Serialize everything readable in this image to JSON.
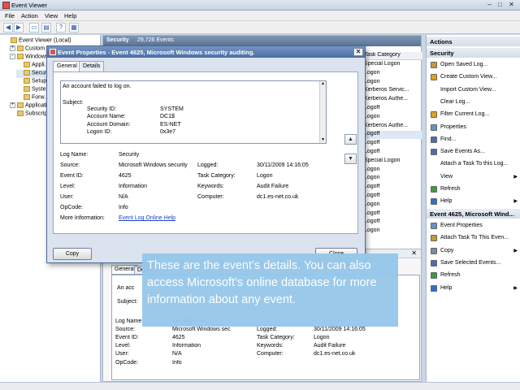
{
  "window": {
    "title": "Event Viewer"
  },
  "menu": [
    "File",
    "Action",
    "View",
    "Help"
  ],
  "toolbar": [
    "back-icon",
    "forward-icon",
    "folder-icon",
    "properties-icon",
    "help-icon",
    "grid-icon"
  ],
  "tree": [
    {
      "label": "Event Viewer (Local)",
      "exp": "",
      "indent": 0
    },
    {
      "label": "Custom V...",
      "exp": "+",
      "indent": 1
    },
    {
      "label": "Windows...",
      "exp": "-",
      "indent": 1
    },
    {
      "label": "Appli...",
      "exp": "",
      "indent": 2
    },
    {
      "label": "Secur...",
      "exp": "",
      "indent": 2,
      "selected": true
    },
    {
      "label": "Setup",
      "exp": "",
      "indent": 2
    },
    {
      "label": "Syste...",
      "exp": "",
      "indent": 2
    },
    {
      "label": "Forw...",
      "exp": "",
      "indent": 2
    },
    {
      "label": "Applicatio...",
      "exp": "+",
      "indent": 1
    },
    {
      "label": "Subscript...",
      "exp": "",
      "indent": 1
    }
  ],
  "center": {
    "title": "Security",
    "count": "29,726 Events",
    "column": "Task Category"
  },
  "list_rows": [
    "Special Logon",
    "Logon",
    "Logon",
    "Kerberos Servic...",
    "Kerberos Authe...",
    "Logoff",
    "Logon",
    "Kerberos Authe...",
    "Logoff",
    "Logoff",
    "Logoff",
    "Special Logon",
    "Logon",
    "Logon",
    "Logoff",
    "Logoff",
    "Logon",
    "Logoff",
    "Logoff",
    "Logon"
  ],
  "dialog": {
    "title": "Event Properties - Event 4625, Microsoft Windows security auditing.",
    "tabs": [
      "General",
      "Details"
    ],
    "message": {
      "line1": "An account failed to log on.",
      "subject": "Subject:",
      "fields": [
        {
          "k": "Security ID:",
          "v": "SYSTEM"
        },
        {
          "k": "Account Name:",
          "v": "DC1$"
        },
        {
          "k": "Account Domain:",
          "v": "ES-NET"
        },
        {
          "k": "Logon ID:",
          "v": "0x3e7"
        }
      ]
    },
    "props": {
      "log_name_label": "Log Name:",
      "log_name": "Security",
      "source_label": "Source:",
      "source": "Microsoft Windows security",
      "logged_label": "Logged:",
      "logged": "30/11/2009 14:16:05",
      "event_id_label": "Event ID:",
      "event_id": "4625",
      "task_label": "Task Category:",
      "task": "Logon",
      "level_label": "Level:",
      "level": "Information",
      "keywords_label": "Keywords:",
      "keywords": "Audit Failure",
      "user_label": "User:",
      "user": "N/A",
      "computer_label": "Computer:",
      "computer": "dc1.es-net.co.uk",
      "opcode_label": "OpCode:",
      "opcode": "Info",
      "more_label": "More Information:",
      "more_link": "Event Log Online Help"
    },
    "copy_button": "Copy",
    "close_button": "Close"
  },
  "lower": {
    "tabs": [
      "General",
      "Details"
    ],
    "msg": "An acc",
    "subject": "Subject:",
    "props": {
      "log_name_label": "Log Name:",
      "log_name": "Security",
      "source_label": "Source:",
      "source": "Microsoft Windows security au",
      "logged_label": "Logged:",
      "logged": "30/11/2009 14:16:05",
      "event_id_label": "Event ID:",
      "event_id": "4625",
      "task_label": "Task Category:",
      "task": "Logon",
      "level_label": "Level:",
      "level": "Information",
      "keywords_label": "Keywords:",
      "keywords": "Audit Failure",
      "user_label": "User:",
      "user": "N/A",
      "computer_label": "Computer:",
      "computer": "dc1.es-net.co.uk",
      "opcode_label": "OpCode:",
      "opcode": "Info"
    }
  },
  "actions": {
    "header": "Actions",
    "section1": "Security",
    "items1": [
      {
        "label": "Open Saved Log...",
        "icon": "#c8963a",
        "arrow": ""
      },
      {
        "label": "Create Custom View...",
        "icon": "#e0a020",
        "arrow": ""
      },
      {
        "label": "Import Custom View...",
        "icon": "#ffffff",
        "arrow": ""
      },
      {
        "label": "Clear Log...",
        "icon": "#ffffff",
        "arrow": ""
      },
      {
        "label": "Filter Current Log...",
        "icon": "#e0a020",
        "arrow": ""
      },
      {
        "label": "Properties",
        "icon": "#6c8fc4",
        "arrow": ""
      },
      {
        "label": "Find...",
        "icon": "#4b6fa8",
        "arrow": ""
      },
      {
        "label": "Save Events As...",
        "icon": "#4b6fa8",
        "arrow": ""
      },
      {
        "label": "Attach a Task To this Log...",
        "icon": "#ffffff",
        "arrow": ""
      },
      {
        "label": "View",
        "icon": "#ffffff",
        "arrow": "▶"
      },
      {
        "label": "Refresh",
        "icon": "#3a9a46",
        "arrow": ""
      },
      {
        "label": "Help",
        "icon": "#2f6fd0",
        "arrow": "▶"
      }
    ],
    "section2": "Event 4625, Microsoft Wind...",
    "items2": [
      {
        "label": "Event Properties",
        "icon": "#6c8fc4",
        "arrow": ""
      },
      {
        "label": "Attach Task To This Even...",
        "icon": "#c8963a",
        "arrow": ""
      },
      {
        "label": "Copy",
        "icon": "#7a8aa0",
        "arrow": "▶"
      },
      {
        "label": "Save Selected Events...",
        "icon": "#4b6fa8",
        "arrow": ""
      },
      {
        "label": "Refresh",
        "icon": "#3a9a46",
        "arrow": ""
      },
      {
        "label": "Help",
        "icon": "#2f6fd0",
        "arrow": "▶"
      }
    ]
  },
  "callout": {
    "text": "These are the event’s details. You can also access Microsoft’s online database for more information about any event."
  }
}
